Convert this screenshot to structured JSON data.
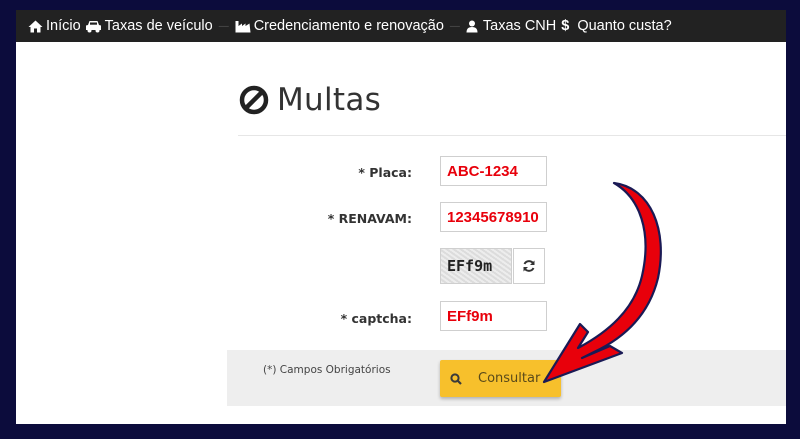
{
  "navbar": {
    "items": [
      {
        "label": "Início",
        "icon": "home-icon"
      },
      {
        "label": "Taxas de veículo",
        "icon": "car-icon"
      },
      {
        "label": "Credenciamento e renovação",
        "icon": "industry-icon"
      },
      {
        "label": "Taxas CNH",
        "icon": "user-icon"
      },
      {
        "label": "Quanto custa?",
        "icon": "dollar-icon"
      }
    ]
  },
  "page": {
    "title": "Multas",
    "title_icon": "ban-icon"
  },
  "form": {
    "placa_label": "* Placa:",
    "placa_value": "ABC-1234",
    "renavam_label": "* RENAVAM:",
    "renavam_value": "12345678910",
    "captcha_image_text": "EFf9m",
    "refresh_icon": "refresh-icon",
    "captcha_label": "* captcha:",
    "captcha_value": "EFf9m",
    "required_note": "(*) Campos Obrigatórios",
    "submit_label": "Consultar",
    "submit_icon": "search-icon"
  },
  "colors": {
    "navbar_bg": "#222222",
    "input_text": "#e8000b",
    "button_bg": "#f7c02c",
    "border_bg": "#0c0c3c",
    "annotation_arrow": "#e8000b"
  }
}
